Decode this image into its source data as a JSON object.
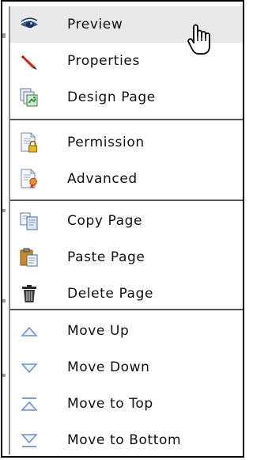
{
  "menu": {
    "items": [
      {
        "label": "Preview",
        "icon": "eye-icon"
      },
      {
        "label": "Properties",
        "icon": "pencil-icon"
      },
      {
        "label": "Design Page",
        "icon": "design-page-icon"
      },
      {
        "label": "Permission",
        "icon": "permission-lock-icon"
      },
      {
        "label": "Advanced",
        "icon": "advanced-ribbon-icon"
      },
      {
        "label": "Copy Page",
        "icon": "copy-icon"
      },
      {
        "label": "Paste Page",
        "icon": "paste-icon"
      },
      {
        "label": "Delete Page",
        "icon": "trash-icon"
      },
      {
        "label": "Move Up",
        "icon": "move-up-icon"
      },
      {
        "label": "Move Down",
        "icon": "move-down-icon"
      },
      {
        "label": "Move to Top",
        "icon": "move-to-top-icon"
      },
      {
        "label": "Move to Bottom",
        "icon": "move-to-bottom-icon"
      }
    ],
    "hovered": "Preview"
  },
  "colors": {
    "hover_background": "#e9e9e9",
    "arrow_icon": "#6a8fd0",
    "pencil": "#d72b1f"
  }
}
